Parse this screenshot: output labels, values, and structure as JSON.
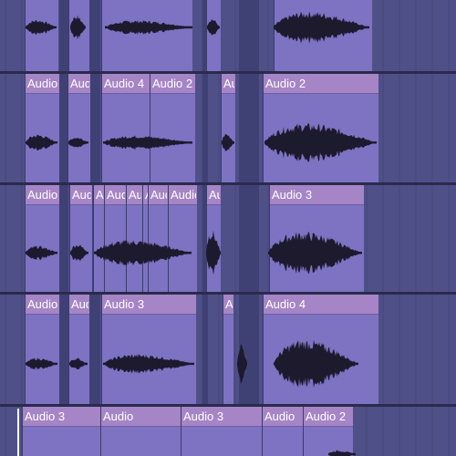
{
  "app": {
    "view": "arrangement",
    "accent_color": "#a585c6",
    "clip_body_color": "#7d73c2",
    "lane_color": "#4f5088",
    "waveform_color": "#1d1a2e"
  },
  "lanes": [
    {
      "clips": [
        {
          "label": ""
        },
        {
          "label": ""
        },
        {
          "label": ""
        },
        {
          "label": ""
        },
        {
          "label": ""
        }
      ]
    },
    {
      "clips": [
        {
          "label": "Audio"
        },
        {
          "label": "Audio"
        },
        {
          "label": "Audio 4"
        },
        {
          "label": "Audio 2"
        },
        {
          "label": "Audio"
        },
        {
          "label": "Audio 2"
        }
      ]
    },
    {
      "clips": [
        {
          "label": "Audio"
        },
        {
          "label": "Audio"
        },
        {
          "label": "Audio"
        },
        {
          "label": "Audio"
        },
        {
          "label": "Audio"
        },
        {
          "label": "Audio"
        },
        {
          "label": "Audio"
        },
        {
          "label": "Audio"
        },
        {
          "label": "Audio"
        },
        {
          "label": "Audio 3"
        }
      ]
    },
    {
      "clips": [
        {
          "label": "Audio"
        },
        {
          "label": "Audio"
        },
        {
          "label": "Audio 3"
        },
        {
          "label": "Audio"
        },
        {
          "label": "Audio 4"
        }
      ]
    },
    {
      "clips": [
        {
          "label": "Audio 3"
        },
        {
          "label": "Audio"
        },
        {
          "label": "Audio 3"
        },
        {
          "label": "Audio"
        },
        {
          "label": "Audio 2"
        }
      ]
    }
  ]
}
